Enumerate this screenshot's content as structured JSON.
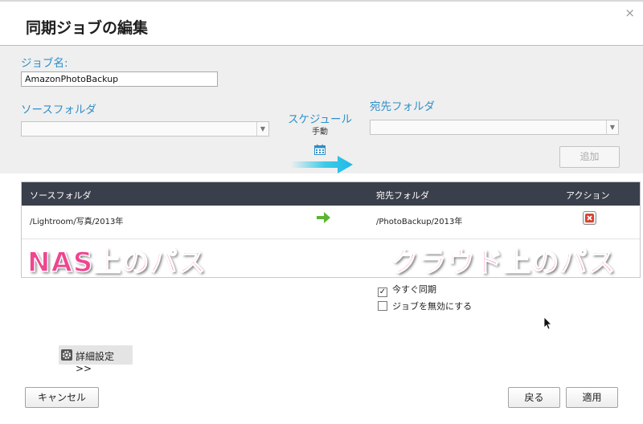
{
  "dialog": {
    "title": "同期ジョブの編集",
    "close_glyph": "×"
  },
  "form": {
    "job_name_label": "ジョブ名:",
    "job_name_value": "AmazonPhotoBackup",
    "source_folder_label": "ソースフォルダ",
    "source_folder_value": "",
    "schedule_label": "スケジュール",
    "schedule_mode": "手動",
    "dest_folder_label": "宛先フォルダ",
    "dest_folder_value": "",
    "add_button": "追加"
  },
  "table": {
    "columns": [
      "ソースフォルダ",
      "宛先フォルダ",
      "アクション"
    ],
    "rows": [
      {
        "source": "/Lightroom/写真/2013年",
        "dest": "/PhotoBackup/2013年"
      }
    ]
  },
  "annotations": {
    "left": "NAS上のパス",
    "right": "クラウド上のパス"
  },
  "options": {
    "sync_now": {
      "label": "今すぐ同期",
      "checked": true
    },
    "disable_job": {
      "label": "ジョブを無効にする",
      "checked": false
    }
  },
  "advanced": {
    "label": "詳細設定 >>"
  },
  "buttons": {
    "cancel": "キャンセル",
    "back": "戻る",
    "apply": "適用"
  },
  "colors": {
    "accent_blue": "#2f8fc8",
    "table_header": "#3a3f4c",
    "annotation_pink": "#f0458f",
    "arrow_cyan": "#29c7e8",
    "arrow_green": "#5cb531",
    "delete_red": "#d9432f"
  },
  "icons": [
    "close-icon",
    "calendar-icon",
    "right-arrow-icon",
    "delete-icon",
    "gear-icon",
    "check-icon",
    "cursor-icon"
  ]
}
